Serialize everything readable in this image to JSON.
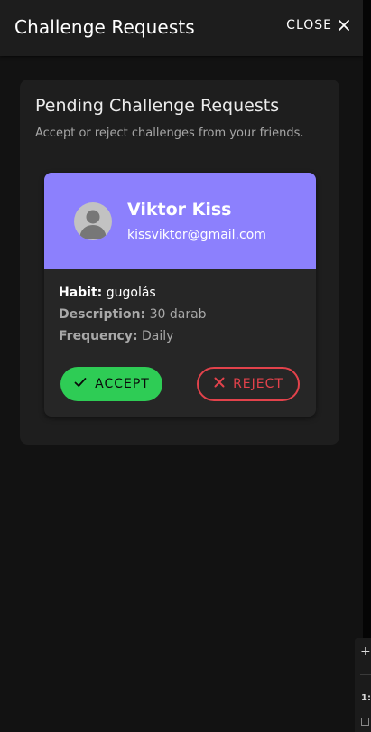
{
  "topbar": {
    "title": "Challenge Requests",
    "close_label": "CLOSE",
    "close_icon": "close-icon"
  },
  "panel": {
    "title": "Pending Challenge Requests",
    "subtitle": "Accept or reject challenges from your friends."
  },
  "requests": [
    {
      "name": "Viktor Kiss",
      "email": "kissviktor@gmail.com",
      "avatar_icon": "person-icon",
      "habit_label": "Habit:",
      "habit": "gugolás",
      "description_label": "Description:",
      "description": "30 darab",
      "frequency_label": "Frequency:",
      "frequency": "Daily",
      "accept_label": "ACCEPT",
      "reject_label": "REJECT"
    }
  ],
  "devtool": {
    "zoom": "1:"
  },
  "colors": {
    "background": "#121212",
    "topbar": "#1d1d1d",
    "panel": "#1e1e1e",
    "card_header": "#8c80fd",
    "card_body": "#262626",
    "accept": "#2ecc55",
    "reject": "#e2424b"
  }
}
